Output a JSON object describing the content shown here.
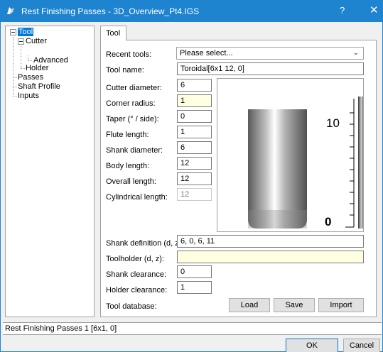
{
  "window": {
    "title": "Rest Finishing Passes - 3D_Overview_Pt4.IGS",
    "help_glyph": "?",
    "close_glyph": "✕"
  },
  "tree": {
    "items": [
      {
        "label": "Tool"
      },
      {
        "label": "Cutter"
      },
      {
        "label": "Advanced"
      },
      {
        "label": "Holder"
      },
      {
        "label": "Passes"
      },
      {
        "label": "Shaft Profile"
      },
      {
        "label": "Inputs"
      }
    ]
  },
  "tabs": [
    {
      "label": "Tool"
    }
  ],
  "form": {
    "recent_tools_label": "Recent tools:",
    "recent_tools_value": "Please select...",
    "tool_name_label": "Tool name:",
    "tool_name_value": "Toroidal[6x1 12, 0]",
    "cutter_diameter_label": "Cutter diameter:",
    "cutter_diameter_value": "6",
    "corner_radius_label": "Corner radius:",
    "corner_radius_value": "1",
    "taper_label": "Taper (° / side):",
    "taper_value": "0",
    "flute_length_label": "Flute length:",
    "flute_length_value": "1",
    "shank_diameter_label": "Shank diameter:",
    "shank_diameter_value": "6",
    "body_length_label": "Body length:",
    "body_length_value": "12",
    "overall_length_label": "Overall length:",
    "overall_length_value": "12",
    "cylindrical_length_label": "Cylindrical length:",
    "cylindrical_length_value": "12",
    "shank_definition_label": "Shank definition (d, z):",
    "shank_definition_value": "6, 0, 6, 11",
    "toolholder_label": "Toolholder (d, z):",
    "toolholder_value": "",
    "shank_clearance_label": "Shank clearance:",
    "shank_clearance_value": "0",
    "holder_clearance_label": "Holder clearance:",
    "holder_clearance_value": "1",
    "tool_database_label": "Tool database:",
    "load_label": "Load",
    "save_label": "Save",
    "import_label": "Import"
  },
  "preview": {
    "ruler_top_label": "10",
    "ruler_bottom_label": "0"
  },
  "status": {
    "text": "Rest Finishing Passes 1 [6x1, 0]"
  },
  "footer": {
    "ok_label": "OK",
    "cancel_label": "Cancel"
  }
}
